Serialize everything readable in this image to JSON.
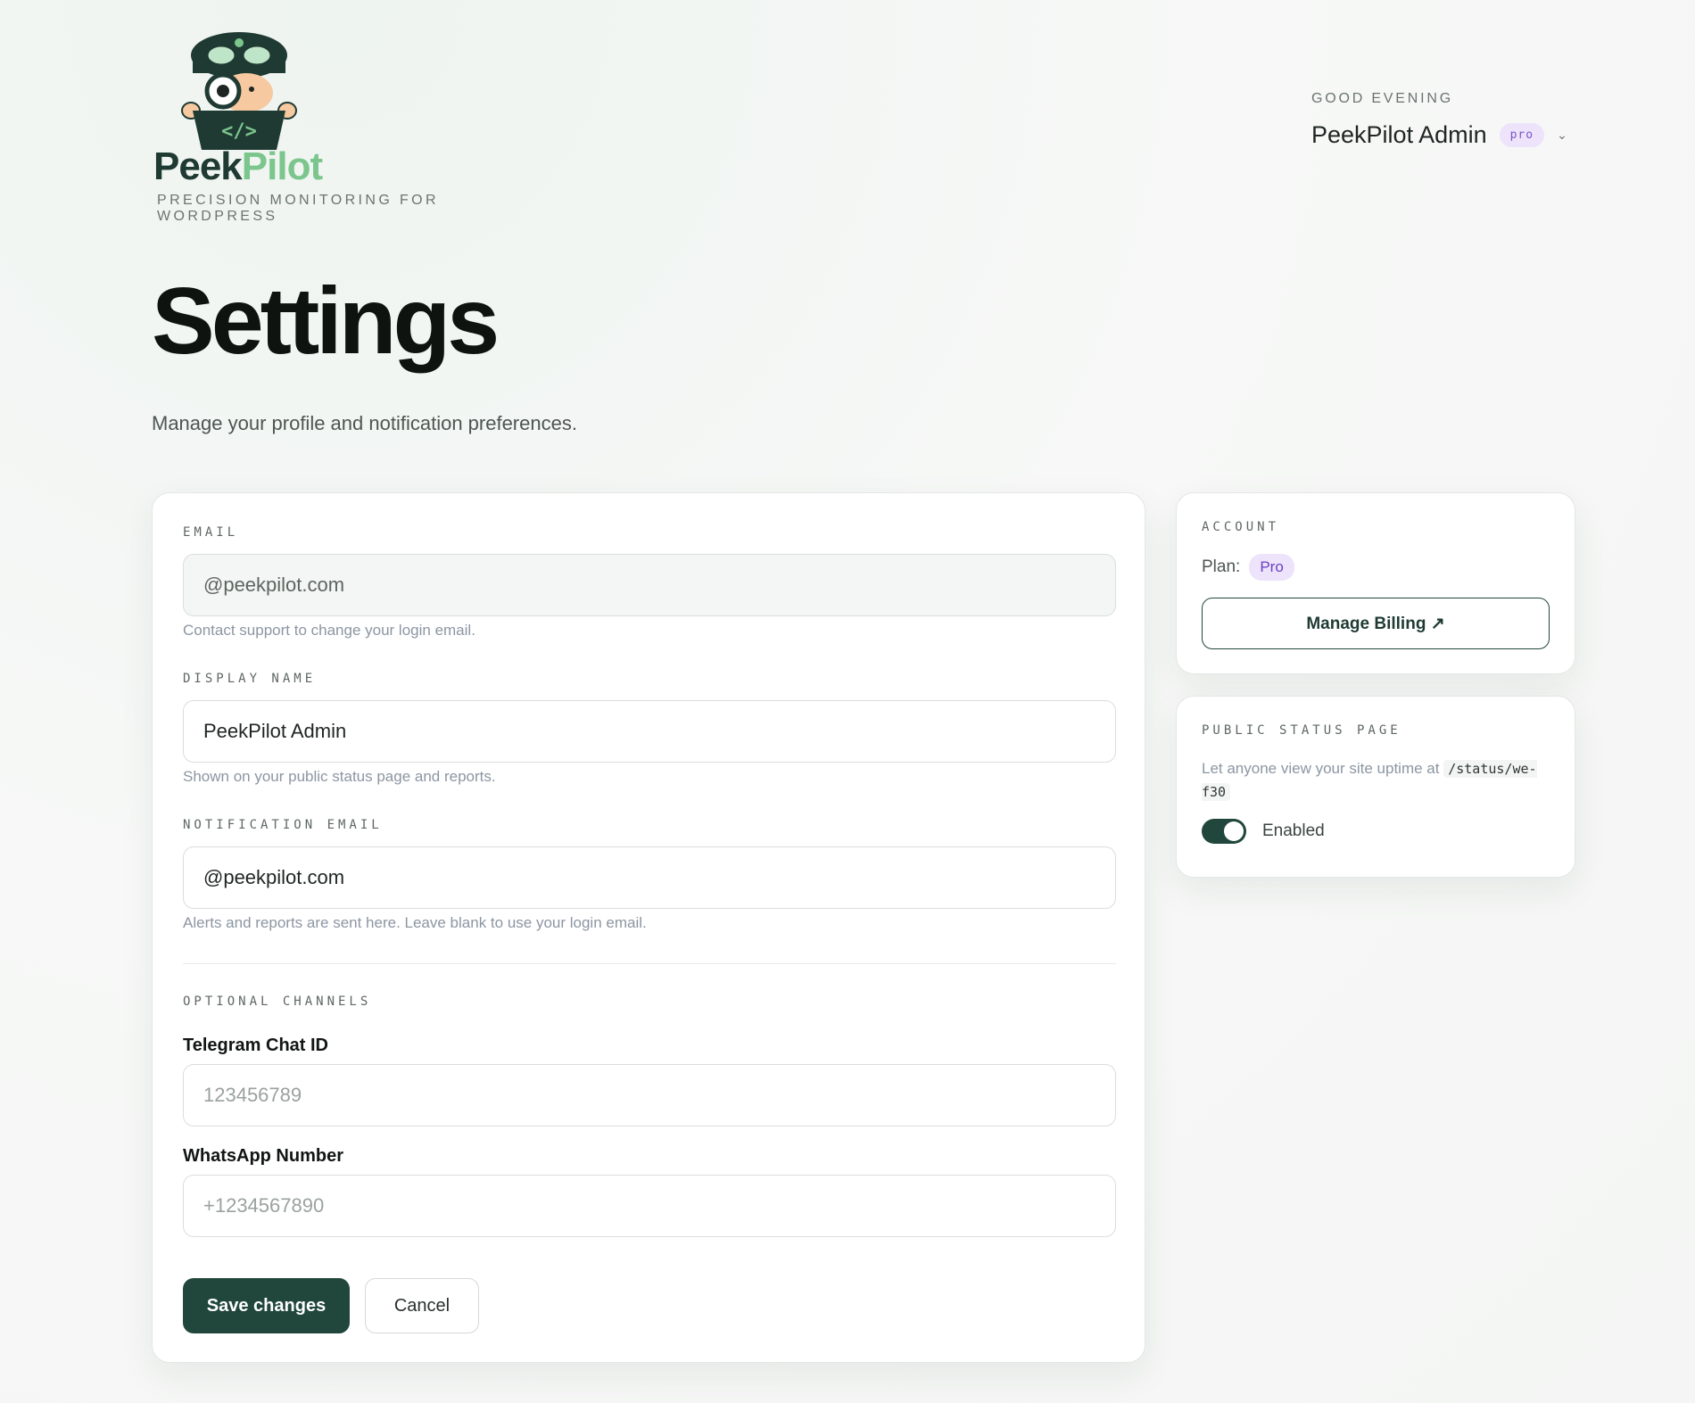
{
  "brand": {
    "name_part1": "Peek",
    "name_part2": "Pilot",
    "tagline": "PRECISION MONITORING FOR WORDPRESS"
  },
  "user": {
    "greeting": "GOOD EVENING",
    "name": "PeekPilot Admin",
    "badge": "pro"
  },
  "page": {
    "title": "Settings",
    "subtitle": "Manage your profile and notification preferences."
  },
  "form": {
    "email_label": "EMAIL",
    "email_value": "@peekpilot.com",
    "email_hint": "Contact support to change your login email.",
    "display_name_label": "DISPLAY NAME",
    "display_name_value": "PeekPilot Admin",
    "display_name_hint": "Shown on your public status page and reports.",
    "notification_email_label": "NOTIFICATION EMAIL",
    "notification_email_value": "@peekpilot.com",
    "notification_email_hint": "Alerts and reports are sent here. Leave blank to use your login email.",
    "optional_channels_label": "OPTIONAL CHANNELS",
    "telegram_label": "Telegram Chat ID",
    "telegram_placeholder": "123456789",
    "whatsapp_label": "WhatsApp Number",
    "whatsapp_placeholder": "+1234567890",
    "save_label": "Save changes",
    "cancel_label": "Cancel"
  },
  "account": {
    "label": "ACCOUNT",
    "plan_label": "Plan:",
    "plan_value": "Pro",
    "billing_label": "Manage Billing ↗"
  },
  "status_page": {
    "label": "PUBLIC STATUS PAGE",
    "description": "Let anyone view your site uptime at",
    "path": "/status/we-f30",
    "toggle_label": "Enabled",
    "enabled": true
  },
  "colors": {
    "brand_dark": "#21473c",
    "brand_green": "#7cc68e",
    "pro_purple": "#ede3fb"
  }
}
